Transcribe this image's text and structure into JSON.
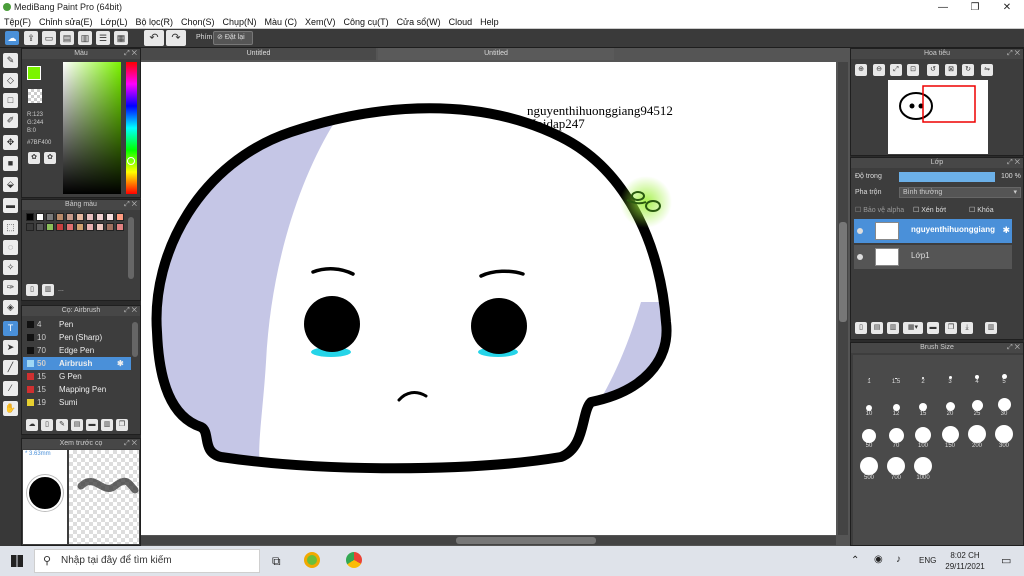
{
  "window": {
    "title": "MediBang Paint Pro (64bit)",
    "minimize": "—",
    "maximize": "❐",
    "close": "✕"
  },
  "menu": [
    "Tệp(F)",
    "Chỉnh sửa(E)",
    "Lớp(L)",
    "Bộ lọc(R)",
    "Chọn(S)",
    "Chụp(N)",
    "Màu (C)",
    "Xem(V)",
    "Công cụ(T)",
    "Cửa sổ(W)",
    "Cloud",
    "Help"
  ],
  "toolbar": {
    "snap_label": "Phím",
    "reset_label": "Đặt lại",
    "undo_icon": "↶",
    "redo_icon": "↷"
  },
  "color_panel": {
    "title": "Màu",
    "r": "R:123",
    "g": "G:244",
    "b": "B:0",
    "hex": "#7BF400",
    "fg_color": "#7bf400",
    "bg_color": "#000000"
  },
  "palette_panel": {
    "title": "Bảng màu",
    "swatches": [
      "#000000",
      "#ffffff",
      "#7a7a7a",
      "#b98a6a",
      "#c89a8a",
      "#e6b8a0",
      "#e8c0c0",
      "#f0d0d0",
      "#f7e0e0",
      "#ff9b80",
      "#3a3a3a",
      "#5a5a5a",
      "#8bbf5a",
      "#c84040",
      "#e07070",
      "#d0a070",
      "#e8b0b0",
      "#f0c8c0",
      "#a07060",
      "#e08080"
    ],
    "ellipsis": "..."
  },
  "brush_panel": {
    "title": "Cọ: Airbrush",
    "items": [
      {
        "size": "4",
        "name": "Pen",
        "color": "#111111"
      },
      {
        "size": "10",
        "name": "Pen (Sharp)",
        "color": "#111111"
      },
      {
        "size": "70",
        "name": "Edge Pen",
        "color": "#111111"
      },
      {
        "size": "50",
        "name": "Airbrush",
        "color": "#9fd7f5",
        "selected": true
      },
      {
        "size": "15",
        "name": "G Pen",
        "color": "#d03030"
      },
      {
        "size": "15",
        "name": "Mapping Pen",
        "color": "#d03030"
      },
      {
        "size": "19",
        "name": "Sumi",
        "color": "#e8d030"
      }
    ],
    "gear_icon": "✱"
  },
  "preview_panel": {
    "title": "Xem trước cọ",
    "size_label": "* 3.63mm"
  },
  "documents": {
    "tab1": "Untitled",
    "tab2": "Untitled"
  },
  "canvas_text": {
    "line1": "nguyenthihuonggiang94512",
    "line2": "Hoidap247"
  },
  "navigator": {
    "title": "Hoa tiêu"
  },
  "layer_panel": {
    "title": "Lớp",
    "opacity_label": "Độ trong",
    "opacity_value": "100 %",
    "opacity": 100,
    "blend_label": "Pha trộn",
    "blend_value": "Bình thường",
    "protect_alpha": "Bảo vệ alpha",
    "clipping": "Xén bớt",
    "lock": "Khóa",
    "layers": [
      {
        "name": "nguyenthihuonggiang",
        "selected": true
      },
      {
        "name": "Lớp1",
        "selected": false
      }
    ]
  },
  "brush_size_panel": {
    "title": "Brush Size",
    "sizes": [
      "1",
      "1.5",
      "2",
      "3",
      "4",
      "5",
      "10",
      "12",
      "15",
      "20",
      "25",
      "30",
      "50",
      "70",
      "100",
      "150",
      "200",
      "300",
      "500",
      "700",
      "1000"
    ]
  },
  "taskbar": {
    "search_placeholder": "Nhập tại đây để tìm kiếm",
    "language": "ENG",
    "time": "8:02 CH",
    "date": "29/11/2021"
  }
}
